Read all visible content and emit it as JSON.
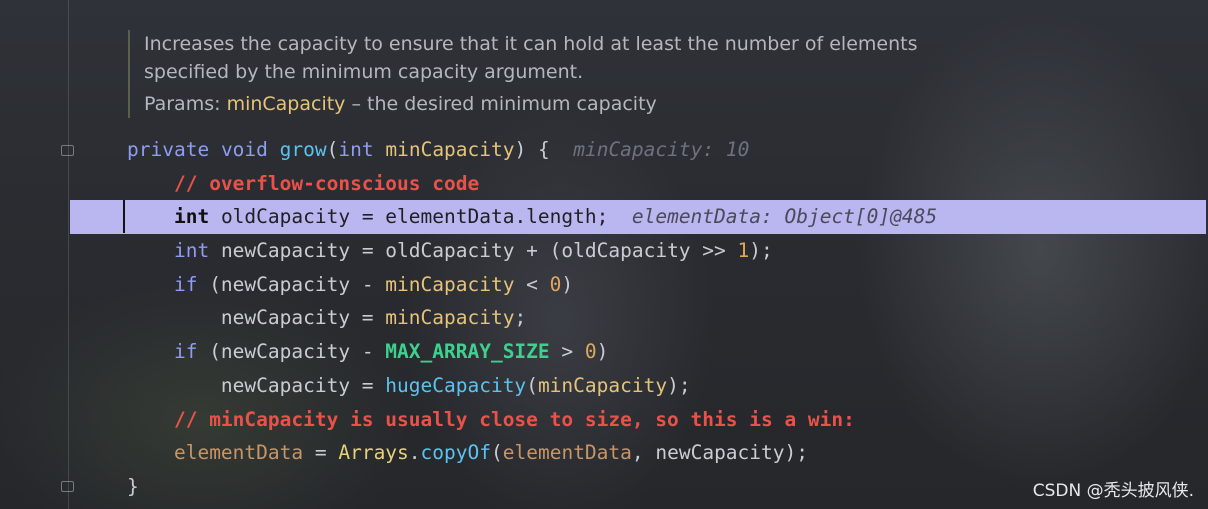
{
  "doc": {
    "line1": "Increases the capacity to ensure that it can hold at least the number of elements",
    "line2": "specified by the minimum capacity argument.",
    "params_label": "Params:",
    "param_name": "minCapacity",
    "param_desc": " – the desired minimum capacity"
  },
  "code": {
    "l1": {
      "kw1": "private",
      "kw2": "void",
      "name": "grow",
      "kw3": "int",
      "param": "minCapacity",
      "tail": ") {",
      "hint": "minCapacity: 10"
    },
    "l2": {
      "comment": "// overflow-conscious code"
    },
    "l3": {
      "kw": "int",
      "body": " oldCapacity = elementData.length;",
      "hint": "elementData: Object[0]@485"
    },
    "l4": {
      "kw": "int",
      "a": " newCapacity = oldCapacity + (oldCapacity >> ",
      "n": "1",
      "b": ");"
    },
    "l5": {
      "kw": "if",
      "a": " (newCapacity - ",
      "p": "minCapacity",
      "b": " < ",
      "n": "0",
      "c": ")"
    },
    "l6": {
      "a": "newCapacity = ",
      "p": "minCapacity",
      "b": ";"
    },
    "l7": {
      "kw": "if",
      "a": " (newCapacity - ",
      "c1": "MAX_ARRAY_SIZE",
      "b": " > ",
      "n": "0",
      "c": ")"
    },
    "l8": {
      "a": "newCapacity = ",
      "fn": "hugeCapacity",
      "b": "(",
      "p": "minCapacity",
      "c": ");"
    },
    "l9": {
      "comment": "// minCapacity is usually close to size, so this is a win:"
    },
    "l10": {
      "f1": "elementData",
      "a": " = ",
      "cls": "Arrays",
      "dot": ".",
      "fn": "copyOf",
      "b": "(",
      "f2": "elementData",
      "c": ", newCapacity);"
    },
    "l11": {
      "a": "}"
    }
  },
  "watermark": "CSDN @秃头披风侠."
}
